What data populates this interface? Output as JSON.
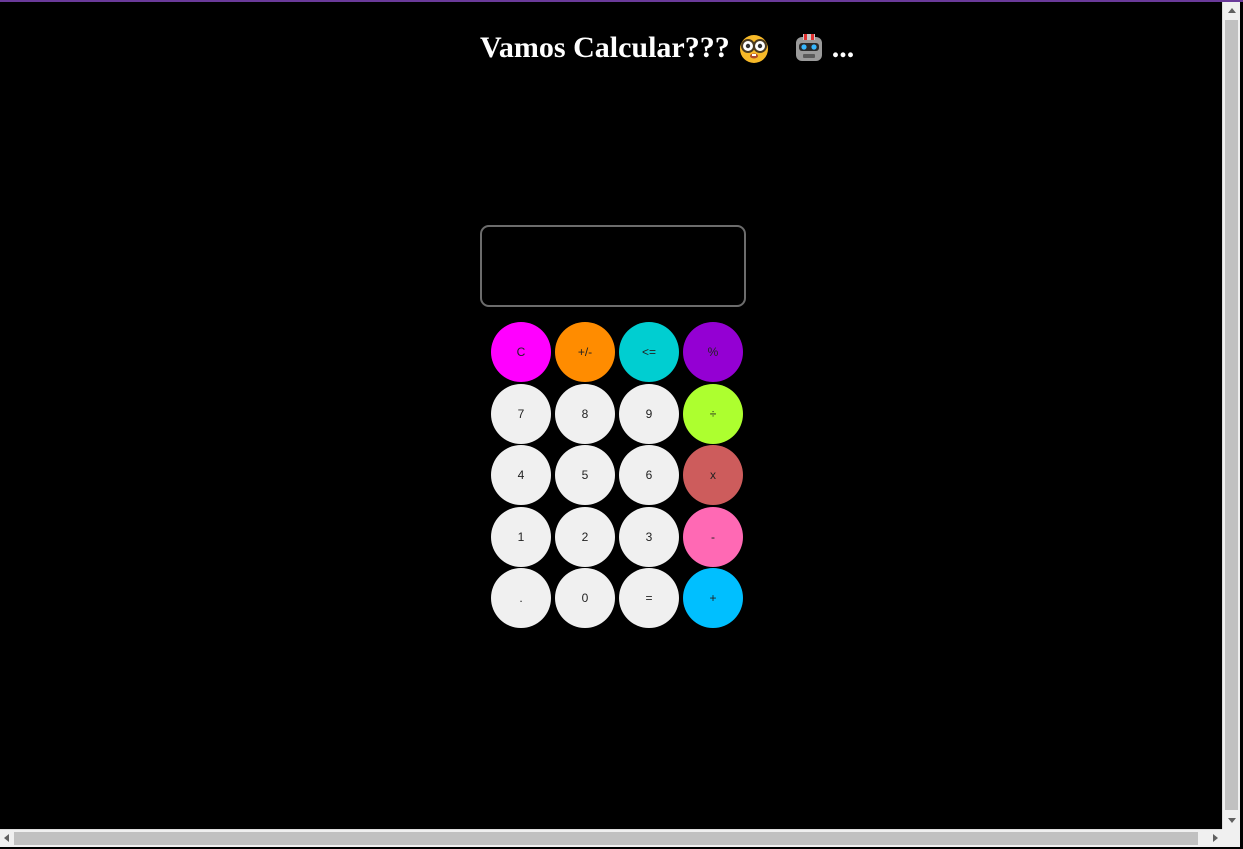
{
  "header": {
    "title": "Vamos Calcular???",
    "suffix": "...",
    "emoji_1": "nerd-face-icon",
    "emoji_2": "robot-icon"
  },
  "display": {
    "value": ""
  },
  "buttons": [
    {
      "label": "C",
      "color": "#ff00ff"
    },
    {
      "label": "+/-",
      "color": "#ff8c00"
    },
    {
      "label": "<=",
      "color": "#00ced1"
    },
    {
      "label": "%",
      "color": "#9400d3"
    },
    {
      "label": "7",
      "color": "#f0f0f0"
    },
    {
      "label": "8",
      "color": "#f0f0f0"
    },
    {
      "label": "9",
      "color": "#f0f0f0"
    },
    {
      "label": "÷",
      "color": "#adff2f"
    },
    {
      "label": "4",
      "color": "#f0f0f0"
    },
    {
      "label": "5",
      "color": "#f0f0f0"
    },
    {
      "label": "6",
      "color": "#f0f0f0"
    },
    {
      "label": "x",
      "color": "#cd5c5c"
    },
    {
      "label": "1",
      "color": "#f0f0f0"
    },
    {
      "label": "2",
      "color": "#f0f0f0"
    },
    {
      "label": "3",
      "color": "#f0f0f0"
    },
    {
      "label": "-",
      "color": "#ff69b4"
    },
    {
      "label": ".",
      "color": "#f0f0f0"
    },
    {
      "label": "0",
      "color": "#f0f0f0"
    },
    {
      "label": "=",
      "color": "#f0f0f0"
    },
    {
      "label": "+",
      "color": "#00bfff"
    }
  ]
}
